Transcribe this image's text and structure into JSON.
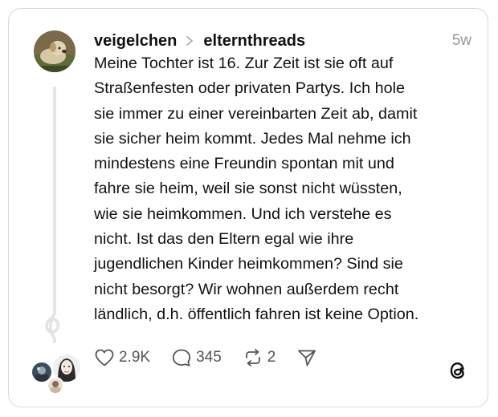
{
  "post": {
    "username": "veigelchen",
    "community": "elternthreads",
    "time": "5w",
    "text": "Meine Tochter ist 16. Zur Zeit ist sie oft auf\nStraßenfesten oder privaten Partys. Ich hole\nsie immer zu einer vereinbarten Zeit ab, damit\nsie sicher heim kommt. Jedes Mal nehme ich\nmindestens eine Freundin spontan mit und\nfahre sie heim, weil sie sonst nicht wüssten,\nwie sie heimkommen. Und ich verstehe es\nnicht. Ist das den Eltern egal wie ihre\njugendlichen Kinder heimkommen? Sind sie\nnicht besorgt? Wir wohnen außerdem recht\nländlich, d.h. öffentlich fahren ist keine Option."
  },
  "actions": {
    "likes": "2.9K",
    "replies": "345",
    "reposts": "2"
  },
  "icons": {
    "like": "heart-icon",
    "reply": "comment-bubble-icon",
    "repost": "repost-icon",
    "share": "send-icon",
    "brand": "threads-logo-icon",
    "separator": "chevron-right-icon"
  },
  "colors": {
    "text": "#111111",
    "muted": "#999999",
    "action": "#555555",
    "border": "#d9d9d9"
  }
}
